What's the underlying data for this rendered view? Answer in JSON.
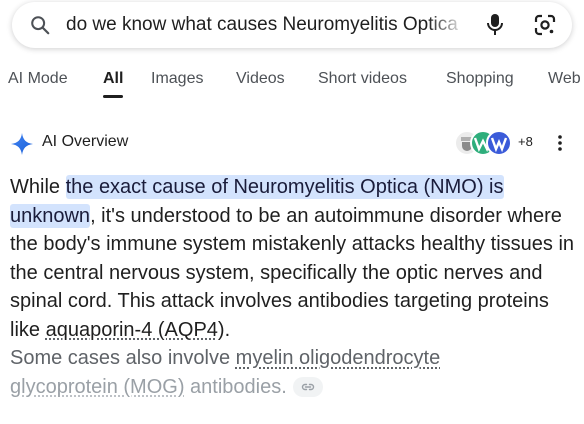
{
  "search": {
    "query": "do we know what causes Neuromyelitis Optica"
  },
  "tabs": [
    {
      "label": "AI Mode"
    },
    {
      "label": "All"
    },
    {
      "label": "Images"
    },
    {
      "label": "Videos"
    },
    {
      "label": "Short videos"
    },
    {
      "label": "Shopping"
    },
    {
      "label": "Web"
    }
  ],
  "ai_overview": {
    "title": "AI Overview",
    "source_count": "+8",
    "body": {
      "p1_lead": "While ",
      "p1_highlight": "the exact cause of Neuromyelitis Optica (NMO) is unknown",
      "p1_rest": ", it's understood to be an autoimmune disorder where the body's immune system mistakenly attacks healthy tissues in the central nervous system, specifically the optic nerves and spinal cord. This attack involves antibodies targeting proteins like ",
      "link_aqp4": "aquaporin-4 (AQP4)",
      "p1_end": ".",
      "p2_lead": "Some cases also involve ",
      "link_mog_1": "myelin oligodendrocyte",
      "link_mog_2": "glycoprotein (MOG)",
      "p2_end": " antibodies."
    }
  },
  "colors": {
    "highlight_bg": "#d3e3fd",
    "accent_blue": "#1a73e8",
    "text": "#1f1f1f",
    "muted": "#4d5156"
  }
}
